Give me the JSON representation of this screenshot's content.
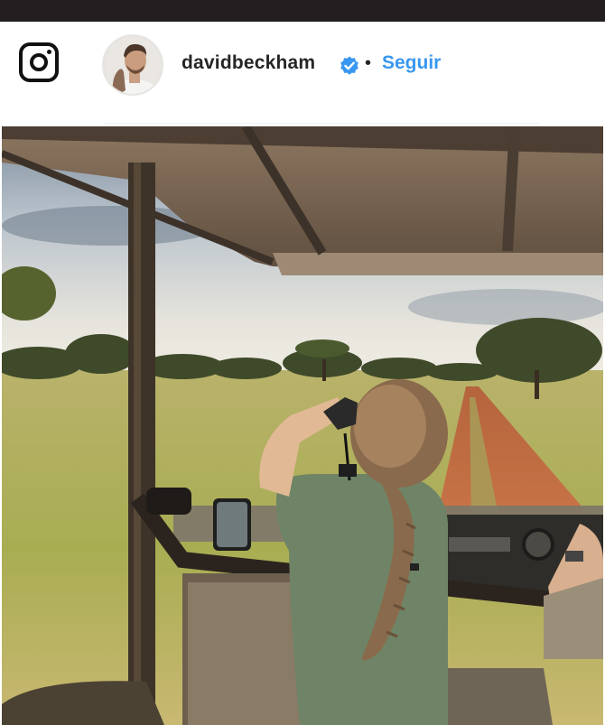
{
  "post_header": {
    "username": "davidbeckham",
    "separator": "•",
    "follow_label": "Seguir"
  },
  "icons": {
    "app": "instagram-icon",
    "verified": "verified-badge-icon"
  },
  "colors": {
    "top_strip": "#231f20",
    "follow_link": "#3897f0",
    "verified_badge": "#3897f0",
    "username_text": "#262626"
  }
}
